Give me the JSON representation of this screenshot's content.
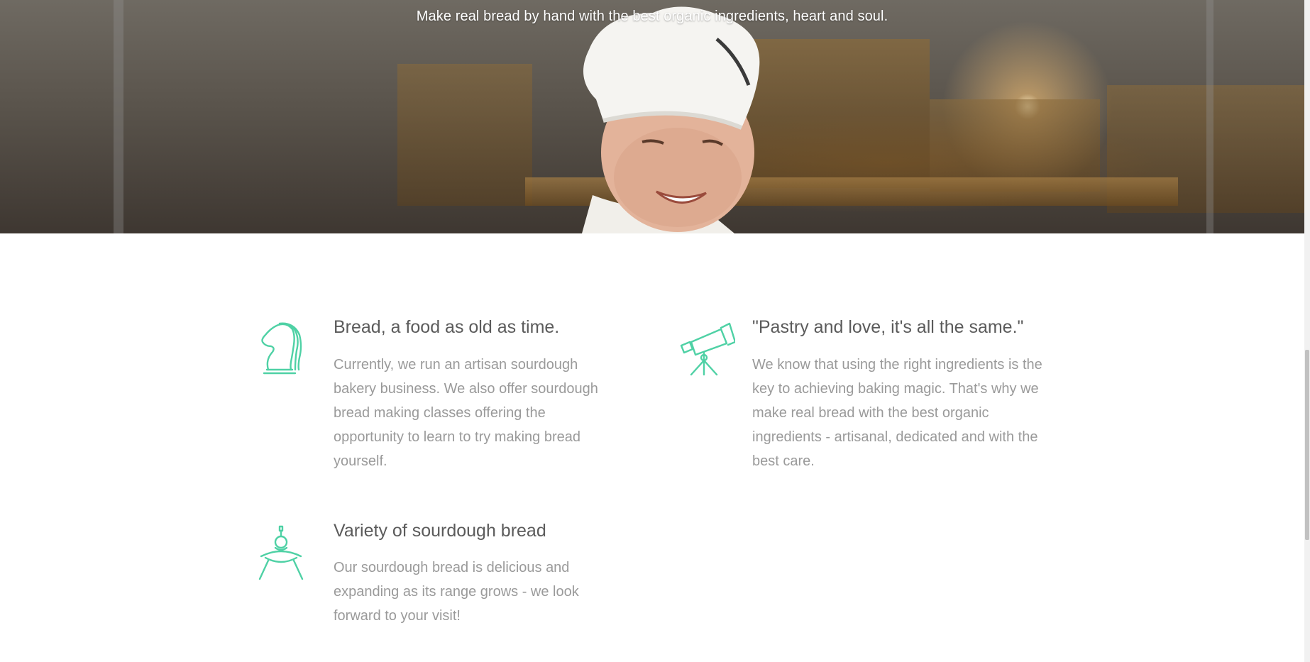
{
  "hero": {
    "subtitle": "Make real bread by hand with the best organic ingredients, heart and soul."
  },
  "features": [
    {
      "icon": "chess-knight-icon",
      "title": "Bread, a food as old as time.",
      "body": "Currently, we run an artisan sourdough bakery business. We also offer sourdough bread making classes offering the opportunity to learn to try making bread yourself."
    },
    {
      "icon": "telescope-icon",
      "title": "\"Pastry and love, it's all the same.\"",
      "body": "We know that using the right ingredients is the key to achieving baking magic. That's why we make real bread with the best organic ingredients - artisanal, dedicated and with the best care."
    },
    {
      "icon": "rocking-horse-icon",
      "title": "Variety of sourdough bread",
      "body": "Our sourdough bread is delicious and expanding as its range grows - we look forward to your visit!"
    }
  ],
  "colors": {
    "accent": "#4fd1a5",
    "title": "#5b5b5b",
    "body": "#9a9a9a"
  }
}
